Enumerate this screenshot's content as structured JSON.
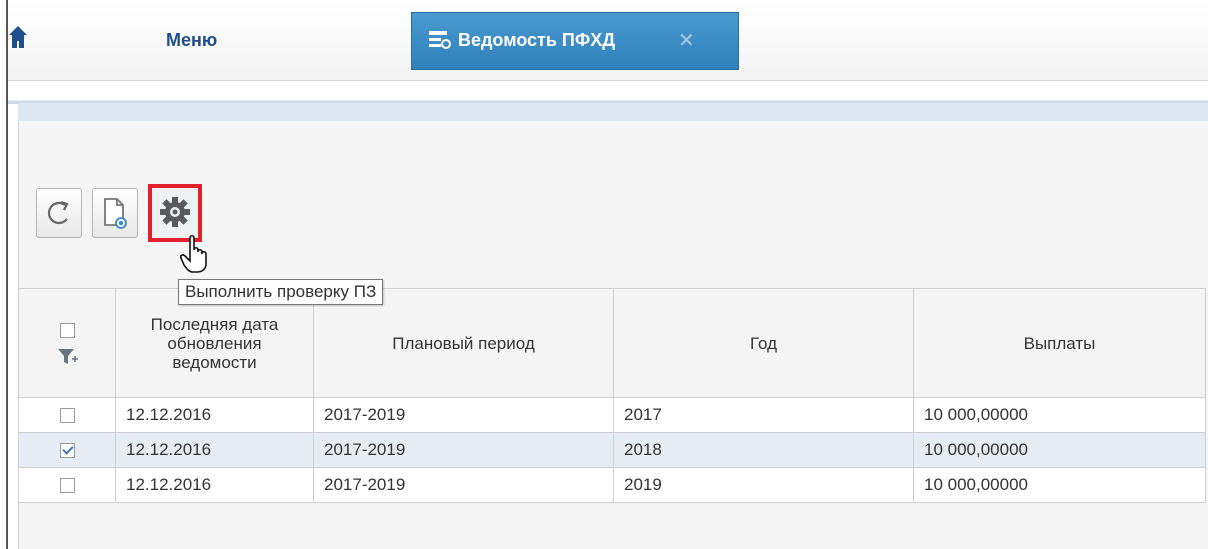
{
  "tabs": {
    "menu_label": "Меню",
    "active_label": "Ведомость ПФХД"
  },
  "toolbar": {
    "refresh_icon": "refresh-icon",
    "preview_icon": "document-preview-icon",
    "check_icon": "gear-icon",
    "tooltip": "Выполнить проверку ПЗ"
  },
  "table": {
    "columns": [
      "Последняя дата обновления ведомости",
      "Плановый период",
      "Год",
      "Выплаты"
    ],
    "rows": [
      {
        "checked": false,
        "date": "12.12.2016",
        "period": "2017-2019",
        "year": "2017",
        "payments": "10 000,00000"
      },
      {
        "checked": true,
        "date": "12.12.2016",
        "period": "2017-2019",
        "year": "2018",
        "payments": "10 000,00000"
      },
      {
        "checked": false,
        "date": "12.12.2016",
        "period": "2017-2019",
        "year": "2019",
        "payments": "10 000,00000"
      }
    ]
  },
  "colors": {
    "active_tab": "#3a8cc6",
    "highlight_border": "#e0202a",
    "selected_row": "#e5ecf4"
  }
}
